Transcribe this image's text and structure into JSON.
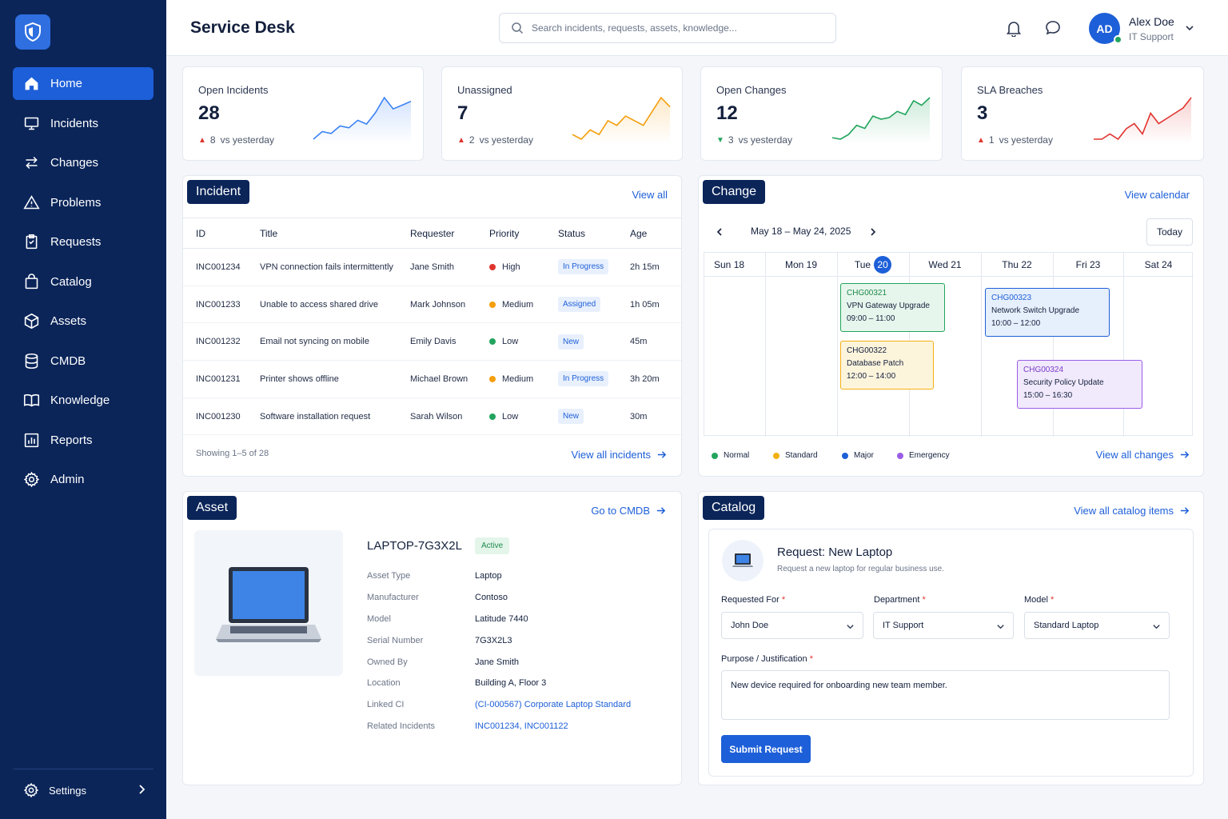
{
  "app": {
    "title": "Service Desk"
  },
  "search": {
    "placeholder": "Search incidents, requests, assets, knowledge..."
  },
  "user": {
    "initials": "AD",
    "name": "Alex Doe",
    "role": "IT Support"
  },
  "sidebar": {
    "items": [
      {
        "label": "Home",
        "icon": "home-icon"
      },
      {
        "label": "Incidents",
        "icon": "monitor-icon"
      },
      {
        "label": "Changes",
        "icon": "swap-arrows-icon"
      },
      {
        "label": "Problems",
        "icon": "warning-triangle-icon"
      },
      {
        "label": "Requests",
        "icon": "clipboard-icon"
      },
      {
        "label": "Catalog",
        "icon": "shopping-bag-icon"
      },
      {
        "label": "Assets",
        "icon": "cube-icon"
      },
      {
        "label": "CMDB",
        "icon": "database-icon"
      },
      {
        "label": "Knowledge",
        "icon": "book-icon"
      },
      {
        "label": "Reports",
        "icon": "bar-chart-icon"
      },
      {
        "label": "Admin",
        "icon": "gear-icon"
      }
    ],
    "settings": "Settings"
  },
  "kpis": [
    {
      "label": "Open Incidents",
      "value": "28",
      "arrow": "▲",
      "delta": "8",
      "suffix": "vs yesterday",
      "color": "#3b82f6",
      "series": [
        10,
        14,
        13,
        17,
        16,
        20,
        18,
        24,
        32,
        26,
        28,
        30
      ]
    },
    {
      "label": "Unassigned",
      "value": "7",
      "arrow": "▲",
      "delta": "2",
      "suffix": "vs yesterday",
      "color": "#f59e0b",
      "series": [
        4,
        3,
        5,
        4,
        7,
        6,
        8,
        7,
        6,
        9,
        12,
        10
      ]
    },
    {
      "label": "Open Changes",
      "value": "12",
      "arrow": "▼",
      "delta": "3",
      "suffix": "vs yesterday",
      "color": "#22a45d",
      "series": [
        4,
        3,
        6,
        12,
        10,
        18,
        16,
        17,
        21,
        19,
        28,
        25,
        30
      ]
    },
    {
      "label": "SLA Breaches",
      "value": "3",
      "arrow": "▲",
      "delta": "1",
      "suffix": "vs yesterday",
      "color": "#e0342f",
      "series": [
        3,
        3,
        4,
        3,
        5,
        6,
        4,
        8,
        6,
        7,
        8,
        9,
        11
      ]
    }
  ],
  "incident": {
    "tag": "Incident",
    "view_all": "View all",
    "columns": [
      "ID",
      "Title",
      "Requester",
      "Priority",
      "Status",
      "Age"
    ],
    "rows": [
      {
        "id": "INC001234",
        "title": "VPN connection fails intermittently",
        "requester": "Jane Smith",
        "priority": "High",
        "priority_color": "#e0342f",
        "status": "In Progress",
        "age": "2h 15m"
      },
      {
        "id": "INC001233",
        "title": "Unable to access shared drive",
        "requester": "Mark Johnson",
        "priority": "Medium",
        "priority_color": "#f59e0b",
        "status": "Assigned",
        "age": "1h 05m"
      },
      {
        "id": "INC001232",
        "title": "Email not syncing on mobile",
        "requester": "Emily Davis",
        "priority": "Low",
        "priority_color": "#22a45d",
        "status": "New",
        "age": "45m"
      },
      {
        "id": "INC001231",
        "title": "Printer shows offline",
        "requester": "Michael Brown",
        "priority": "Medium",
        "priority_color": "#f59e0b",
        "status": "In Progress",
        "age": "3h 20m"
      },
      {
        "id": "INC001230",
        "title": "Software installation request",
        "requester": "Sarah Wilson",
        "priority": "Low",
        "priority_color": "#22a45d",
        "status": "New",
        "age": "30m"
      }
    ],
    "showing": "Showing 1–5 of 28",
    "view_all_incidents": "View all incidents"
  },
  "change": {
    "tag": "Change",
    "view_calendar": "View calendar",
    "range": "May 18 – May 24, 2025",
    "today": "Today",
    "days": [
      {
        "name": "Sun",
        "num": "18"
      },
      {
        "name": "Mon",
        "num": "19"
      },
      {
        "name": "Tue",
        "num": "20",
        "today": true
      },
      {
        "name": "Wed",
        "num": "21"
      },
      {
        "name": "Thu",
        "num": "22"
      },
      {
        "name": "Fri",
        "num": "23"
      },
      {
        "name": "Sat",
        "num": "24"
      }
    ],
    "events": [
      {
        "id": "CHG00321",
        "title": "VPN Gateway Upgrade",
        "time": "09:00 – 11:00",
        "type": "Normal"
      },
      {
        "id": "CHG00322",
        "title": "Database Patch",
        "time": "12:00 – 14:00",
        "type": "Standard"
      },
      {
        "id": "CHG00323",
        "title": "Network Switch Upgrade",
        "time": "10:00 – 12:00",
        "type": "Major"
      },
      {
        "id": "CHG00324",
        "title": "Security Policy Update",
        "time": "15:00 – 16:30",
        "type": "Emergency"
      }
    ],
    "legend": [
      {
        "label": "Normal",
        "color": "#22a45d"
      },
      {
        "label": "Standard",
        "color": "#f5b014"
      },
      {
        "label": "Major",
        "color": "#1d5fd8"
      },
      {
        "label": "Emergency",
        "color": "#9b5de5"
      }
    ],
    "view_all_changes": "View all changes"
  },
  "asset": {
    "tag": "Asset",
    "go_to_cmdb": "Go to CMDB",
    "name": "LAPTOP-7G3X2L",
    "status": "Active",
    "props": [
      {
        "key": "Asset Type",
        "value": "Laptop"
      },
      {
        "key": "Manufacturer",
        "value": "Contoso"
      },
      {
        "key": "Model",
        "value": "Latitude 7440"
      },
      {
        "key": "Serial Number",
        "value": "7G3X2L3"
      },
      {
        "key": "Owned By",
        "value": "Jane Smith"
      },
      {
        "key": "Location",
        "value": "Building A, Floor 3"
      },
      {
        "key": "Linked CI",
        "value": "(CI-000567) Corporate Laptop Standard",
        "link": true
      },
      {
        "key": "Related Incidents",
        "value": "INC001234, INC001122",
        "link": true
      }
    ]
  },
  "catalog": {
    "tag": "Catalog",
    "view_all": "View all catalog items",
    "request_title": "Request:  New Laptop",
    "request_sub": "Request a new laptop for regular business use.",
    "fields": {
      "requested_for": {
        "label": "Requested For",
        "value": "John Doe"
      },
      "department": {
        "label": "Department",
        "value": "IT Support"
      },
      "model": {
        "label": "Model",
        "value": "Standard Laptop"
      },
      "purpose": {
        "label": "Purpose / Justification",
        "value": "New device required for onboarding new team member."
      }
    },
    "required_mark": "*",
    "submit": "Submit Request"
  }
}
